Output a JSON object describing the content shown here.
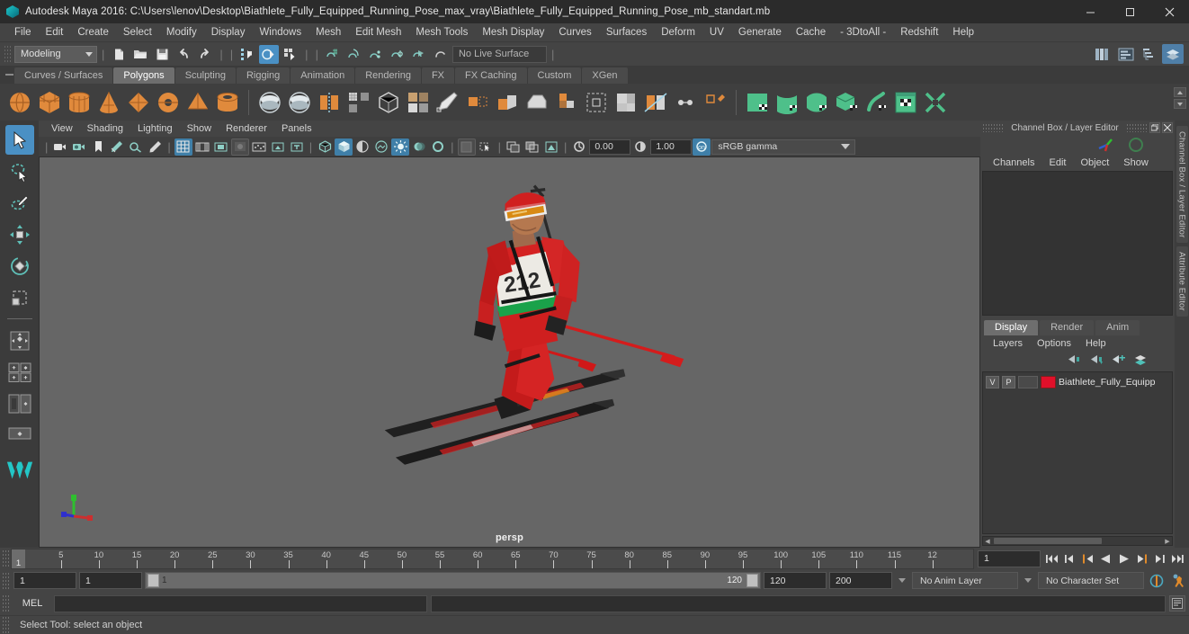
{
  "window": {
    "title": "Autodesk Maya 2016: C:\\Users\\lenov\\Desktop\\Biathlete_Fully_Equipped_Running_Pose_max_vray\\Biathlete_Fully_Equipped_Running_Pose_mb_standart.mb",
    "logo_icon": "maya-logo-icon",
    "minimize_icon": "minimize-icon",
    "maximize_icon": "maximize-icon",
    "close_icon": "close-icon"
  },
  "menubar": {
    "items": [
      {
        "label": "File"
      },
      {
        "label": "Edit"
      },
      {
        "label": "Create"
      },
      {
        "label": "Select"
      },
      {
        "label": "Modify"
      },
      {
        "label": "Display"
      },
      {
        "label": "Windows"
      },
      {
        "label": "Mesh"
      },
      {
        "label": "Edit Mesh"
      },
      {
        "label": "Mesh Tools"
      },
      {
        "label": "Mesh Display"
      },
      {
        "label": "Curves"
      },
      {
        "label": "Surfaces"
      },
      {
        "label": "Deform"
      },
      {
        "label": "UV"
      },
      {
        "label": "Generate"
      },
      {
        "label": "Cache"
      },
      {
        "label": "- 3DtoAll -"
      },
      {
        "label": "Redshift"
      },
      {
        "label": "Help"
      }
    ]
  },
  "statusbar": {
    "menu_set": "Modeling",
    "menu_set_caret_icon": "chevron-down-icon",
    "file_buttons": [
      {
        "name": "new-scene-button",
        "icon": "new-file-icon"
      },
      {
        "name": "open-scene-button",
        "icon": "open-folder-icon"
      },
      {
        "name": "save-scene-button",
        "icon": "save-disk-icon"
      },
      {
        "name": "undo-button",
        "icon": "undo-arrow-icon"
      },
      {
        "name": "redo-button",
        "icon": "redo-arrow-icon"
      }
    ],
    "select_mode_buttons": [
      {
        "name": "select-by-hierarchy-button",
        "icon": "hierarchy-select-icon",
        "active": false
      },
      {
        "name": "select-by-object-type-button",
        "icon": "object-select-icon",
        "active": true
      },
      {
        "name": "select-by-component-type-button",
        "icon": "component-select-icon",
        "active": false
      }
    ],
    "snap_buttons": [
      {
        "name": "snap-to-grid-button",
        "icon": "snap-grid-icon"
      },
      {
        "name": "snap-to-curve-button",
        "icon": "snap-curve-icon"
      },
      {
        "name": "snap-to-point-button",
        "icon": "snap-point-icon"
      },
      {
        "name": "snap-to-projected-center-button",
        "icon": "snap-projected-center-icon"
      },
      {
        "name": "snap-to-view-plane-button",
        "icon": "snap-view-plane-icon"
      },
      {
        "name": "make-live-button",
        "icon": "make-live-icon"
      }
    ],
    "live_surface_label": "No Live Surface",
    "editor_buttons": [
      {
        "name": "show-hide-attribute-editor",
        "icon": "attribute-editor-icon",
        "selected": false
      },
      {
        "name": "show-hide-tool-settings",
        "icon": "tool-settings-icon",
        "selected": false
      },
      {
        "name": "show-hide-channel-box-outliner",
        "icon": "outliner-icon",
        "selected": false
      },
      {
        "name": "show-hide-channel-box",
        "icon": "channel-box-icon",
        "selected": true
      }
    ]
  },
  "shelf": {
    "tabs": [
      {
        "label": "Curves / Surfaces",
        "active": false
      },
      {
        "label": "Polygons",
        "active": true
      },
      {
        "label": "Sculpting",
        "active": false
      },
      {
        "label": "Rigging",
        "active": false
      },
      {
        "label": "Animation",
        "active": false
      },
      {
        "label": "Rendering",
        "active": false
      },
      {
        "label": "FX",
        "active": false
      },
      {
        "label": "FX Caching",
        "active": false
      },
      {
        "label": "Custom",
        "active": false
      },
      {
        "label": "XGen",
        "active": false
      }
    ],
    "icons": [
      {
        "name": "poly-sphere-button",
        "icon": "poly-sphere-icon",
        "color": "#e08a3c",
        "shape": "sphere"
      },
      {
        "name": "poly-cube-button",
        "icon": "poly-cube-icon",
        "color": "#e08a3c",
        "shape": "cube"
      },
      {
        "name": "poly-cylinder-button",
        "icon": "poly-cylinder-icon",
        "color": "#e08a3c",
        "shape": "cylinder"
      },
      {
        "name": "poly-cone-button",
        "icon": "poly-cone-icon",
        "color": "#e08a3c",
        "shape": "cone"
      },
      {
        "name": "poly-plane-button",
        "icon": "poly-plane-icon",
        "color": "#e08a3c",
        "shape": "diamond"
      },
      {
        "name": "poly-torus-button",
        "icon": "poly-torus-icon",
        "color": "#e08a3c",
        "shape": "torus"
      },
      {
        "name": "poly-prism-button",
        "icon": "poly-prism-icon",
        "color": "#e08a3c",
        "shape": "pyramid"
      },
      {
        "name": "poly-pipe-button",
        "icon": "poly-pipe-icon",
        "color": "#e08a3c",
        "shape": "pipe"
      },
      {
        "name": "sep",
        "icon": "separator"
      },
      {
        "name": "poly-booleans-union-button",
        "icon": "boolean-union-icon",
        "color": "#b9c4c9",
        "shape": "disc2"
      },
      {
        "name": "poly-booleans-difference-button",
        "icon": "boolean-difference-icon",
        "color": "#b9c4c9",
        "shape": "disc2"
      },
      {
        "name": "poly-mirror-geometry-button",
        "icon": "mirror-geometry-icon",
        "color": "#e08a3c",
        "shape": "mirror"
      },
      {
        "name": "poly-smooth-button",
        "icon": "smooth-icon",
        "color": "#d8d8d8",
        "shape": "grid"
      },
      {
        "name": "poly-reduce-button",
        "icon": "reduce-icon",
        "color": "#cfcfcf",
        "shape": "wirecube"
      },
      {
        "name": "poly-remesh-button",
        "icon": "remesh-icon",
        "color": "#d0a070",
        "shape": "gridsplit"
      },
      {
        "name": "poly-create-tool-button",
        "icon": "create-poly-tool-icon",
        "color": "#d8d8d8",
        "shape": "pen"
      },
      {
        "name": "poly-append-button",
        "icon": "append-polygon-icon",
        "color": "#e08a3c",
        "shape": "append"
      },
      {
        "name": "poly-extrude-button",
        "icon": "extrude-icon",
        "color": "#e08a3c",
        "shape": "extrude"
      },
      {
        "name": "poly-bevel-button",
        "icon": "bevel-icon",
        "color": "#d8d8d8",
        "shape": "bevel"
      },
      {
        "name": "poly-combine-button",
        "icon": "combine-icon",
        "color": "#e08a3c",
        "shape": "combine"
      },
      {
        "name": "poly-bridge-button",
        "icon": "bridge-icon",
        "color": "#cfcfcf",
        "shape": "bridgebox"
      },
      {
        "name": "poly-fill-hole-button",
        "icon": "fill-hole-icon",
        "color": "#cfcfcf",
        "shape": "fillhole"
      },
      {
        "name": "poly-slice-button",
        "icon": "multi-cut-icon",
        "color": "#e08a3c",
        "shape": "slice"
      },
      {
        "name": "poly-target-weld-button",
        "icon": "target-weld-icon",
        "color": "#cfcfcf",
        "shape": "targetweld"
      },
      {
        "name": "poly-quad-draw-button",
        "icon": "quad-draw-icon",
        "color": "#e08a3c",
        "shape": "quaddraw"
      },
      {
        "name": "sep2",
        "icon": "separator"
      },
      {
        "name": "uv-planar-button",
        "icon": "uv-planar-icon",
        "color": "#4ec08a",
        "shape": "uvplane"
      },
      {
        "name": "uv-cylindrical-button",
        "icon": "uv-cylindrical-icon",
        "color": "#4ec08a",
        "shape": "uvcyl"
      },
      {
        "name": "uv-spherical-button",
        "icon": "uv-spherical-icon",
        "color": "#4ec08a",
        "shape": "uvsph"
      },
      {
        "name": "uv-automatic-button",
        "icon": "uv-automatic-icon",
        "color": "#4ec08a",
        "shape": "uvauto"
      },
      {
        "name": "uv-unfold-button",
        "icon": "uv-unfold-icon",
        "color": "#4ec08a",
        "shape": "uvunfold"
      },
      {
        "name": "uv-editor-button",
        "icon": "uv-editor-icon",
        "color": "#4ec08a",
        "shape": "uveditor"
      },
      {
        "name": "uv-cut-button",
        "icon": "uv-cut-icon",
        "color": "#4ec08a",
        "shape": "uvcut"
      }
    ]
  },
  "toolbox": {
    "tools": [
      {
        "name": "select-tool",
        "icon": "arrow-cursor-icon",
        "active": true
      },
      {
        "name": "lasso-select-tool",
        "icon": "lasso-select-icon",
        "active": false
      },
      {
        "name": "paint-select-tool",
        "icon": "paint-brush-icon",
        "active": false
      },
      {
        "name": "move-tool",
        "icon": "move-arrows-icon",
        "active": false
      },
      {
        "name": "rotate-tool",
        "icon": "rotate-circle-icon",
        "active": false
      },
      {
        "name": "scale-tool",
        "icon": "scale-box-icon",
        "active": false
      }
    ],
    "layouts": [
      {
        "name": "layout-single-pane",
        "icon": "single-pane-icon"
      },
      {
        "name": "layout-four-pane",
        "icon": "four-pane-icon"
      },
      {
        "name": "layout-two-pane-side",
        "icon": "two-pane-side-icon"
      },
      {
        "name": "layout-persp-outliner",
        "icon": "persp-outliner-icon"
      }
    ],
    "bottom_icon": "maya-teal-logo-icon"
  },
  "viewport": {
    "menus": [
      {
        "label": "View"
      },
      {
        "label": "Shading"
      },
      {
        "label": "Lighting"
      },
      {
        "label": "Show"
      },
      {
        "label": "Renderer"
      },
      {
        "label": "Panels"
      }
    ],
    "toolbar": {
      "camera_buttons": [
        {
          "name": "select-camera-button",
          "icon": "camera-icon"
        },
        {
          "name": "camera-attributes-button",
          "icon": "camera-attributes-icon"
        },
        {
          "name": "bookmark-button",
          "icon": "bookmark-icon"
        },
        {
          "name": "image-plane-button",
          "icon": "image-plane-icon"
        },
        {
          "name": "two-d-pan-zoom-button",
          "icon": "pan-zoom-icon"
        },
        {
          "name": "grease-pencil-button",
          "icon": "grease-pencil-icon"
        }
      ],
      "display_buttons": [
        {
          "name": "grid-toggle-button",
          "icon": "grid-icon",
          "active": true
        },
        {
          "name": "film-gate-button",
          "icon": "film-gate-icon",
          "active": false
        },
        {
          "name": "resolution-gate-button",
          "icon": "resolution-gate-icon",
          "active": false
        },
        {
          "name": "gate-mask-button",
          "icon": "gate-mask-icon",
          "active": false
        },
        {
          "name": "film-origin-button",
          "icon": "film-origin-icon",
          "active": false
        },
        {
          "name": "exposure-button",
          "icon": "exposure-icon",
          "active": false
        },
        {
          "name": "safe-title-button",
          "icon": "safe-title-icon",
          "active": false
        }
      ],
      "shading_buttons": [
        {
          "name": "wireframe-button",
          "icon": "wireframe-icon",
          "active": false
        },
        {
          "name": "smooth-shade-button",
          "icon": "smooth-shade-icon",
          "active": true
        },
        {
          "name": "shaded-wireframe-button",
          "icon": "shaded-wireframe-icon",
          "active": false
        },
        {
          "name": "textured-button",
          "icon": "textured-icon",
          "active": false
        },
        {
          "name": "use-all-lights-button",
          "icon": "all-lights-icon",
          "active": true
        },
        {
          "name": "shadows-button",
          "icon": "shadow-icon",
          "active": false
        },
        {
          "name": "ao-button",
          "icon": "ambient-occlusion-icon",
          "active": false
        }
      ],
      "xray_buttons": [
        {
          "name": "xray-button",
          "icon": "xray-icon"
        },
        {
          "name": "xray-joints-button",
          "icon": "xray-joints-icon"
        },
        {
          "name": "xray-active-components-button",
          "icon": "xray-components-icon"
        },
        {
          "name": "isolate-select-button",
          "icon": "isolate-select-icon"
        }
      ],
      "render_buttons": [
        {
          "name": "render-region-button",
          "icon": "render-region-icon"
        },
        {
          "name": "viewport-snapshot-button",
          "icon": "snapshot-icon"
        },
        {
          "name": "ipr-button",
          "icon": "ipr-icon"
        }
      ],
      "exposure_value": "0.00",
      "gamma_value": "1.00",
      "exposure_icon": "exposure-dial-icon",
      "gamma_icon": "gamma-dial-icon",
      "view-transform-toggle-icon": "color-management-icon",
      "color_space": "sRGB gamma",
      "color_space_caret_icon": "chevron-down-icon"
    },
    "camera_label": "persp",
    "scene_object": "Biathlete in red racing suit on skis with rifle and poles, bib number 212",
    "bib_number": "212",
    "axis_gizmo": {
      "name": "axis-gizmo",
      "x_color": "#cc3333",
      "y_color": "#33cc33",
      "z_color": "#3333cc"
    },
    "background_color": "#666666"
  },
  "right_panel": {
    "title": "Channel Box / Layer Editor",
    "undock_icon": "undock-icon",
    "close_icon": "close-icon",
    "channel_menus": [
      {
        "label": "Channels"
      },
      {
        "label": "Edit"
      },
      {
        "label": "Object"
      },
      {
        "label": "Show"
      }
    ],
    "layer_tabs": [
      {
        "label": "Display",
        "active": true
      },
      {
        "label": "Render",
        "active": false
      },
      {
        "label": "Anim",
        "active": false
      }
    ],
    "layer_menus": [
      {
        "label": "Layers"
      },
      {
        "label": "Options"
      },
      {
        "label": "Help"
      }
    ],
    "layer_toolbar_icons": [
      {
        "name": "move-layer-up-button",
        "icon": "layer-up-icon"
      },
      {
        "name": "move-layer-down-button",
        "icon": "layer-down-icon"
      },
      {
        "name": "new-layer-button",
        "icon": "new-layer-icon"
      },
      {
        "name": "new-layer-from-selected-button",
        "icon": "new-layer-from-selected-icon"
      }
    ],
    "layers": [
      {
        "visibility": "V",
        "playback": "P",
        "color": "#e0102a",
        "name": "Biathlete_Fully_Equipp"
      }
    ],
    "side_tabs": [
      {
        "label": "Channel Box / Layer Editor"
      },
      {
        "label": "Attribute Editor"
      }
    ]
  },
  "timeline": {
    "tick_labels": [
      "5",
      "10",
      "15",
      "20",
      "25",
      "30",
      "35",
      "40",
      "45",
      "50",
      "55",
      "60",
      "65",
      "70",
      "75",
      "80",
      "85",
      "90",
      "95",
      "100",
      "105",
      "110",
      "115",
      "12"
    ],
    "current_frame": "1",
    "current_frame_field": "1",
    "playback_buttons": [
      {
        "name": "go-to-start-button",
        "icon": "skip-to-start-icon"
      },
      {
        "name": "step-back-keyframe-button",
        "icon": "previous-key-icon"
      },
      {
        "name": "step-back-frame-button",
        "icon": "previous-frame-icon"
      },
      {
        "name": "play-backwards-button",
        "icon": "play-reverse-icon"
      },
      {
        "name": "play-forwards-button",
        "icon": "play-icon"
      },
      {
        "name": "step-forward-frame-button",
        "icon": "next-frame-icon"
      },
      {
        "name": "step-forward-keyframe-button",
        "icon": "next-key-icon"
      },
      {
        "name": "go-to-end-button",
        "icon": "skip-to-end-icon"
      }
    ]
  },
  "range": {
    "animation_start": "1",
    "playback_start": "1",
    "slider_start_label": "1",
    "slider_end_label": "120",
    "playback_end": "120",
    "animation_end": "200",
    "anim_layer": "No Anim Layer",
    "anim_layer_caret_icon": "chevron-down-icon",
    "character_set": "No Character Set",
    "character_set_caret_icon": "chevron-down-icon",
    "auto_key_icon": "auto-keyframe-icon",
    "animation_preferences_icon": "animation-preferences-icon"
  },
  "command_line": {
    "label": "MEL",
    "input_value": "",
    "output_value": "",
    "script_editor_icon": "script-editor-icon"
  },
  "help_line": {
    "text": "Select Tool: select an object"
  }
}
